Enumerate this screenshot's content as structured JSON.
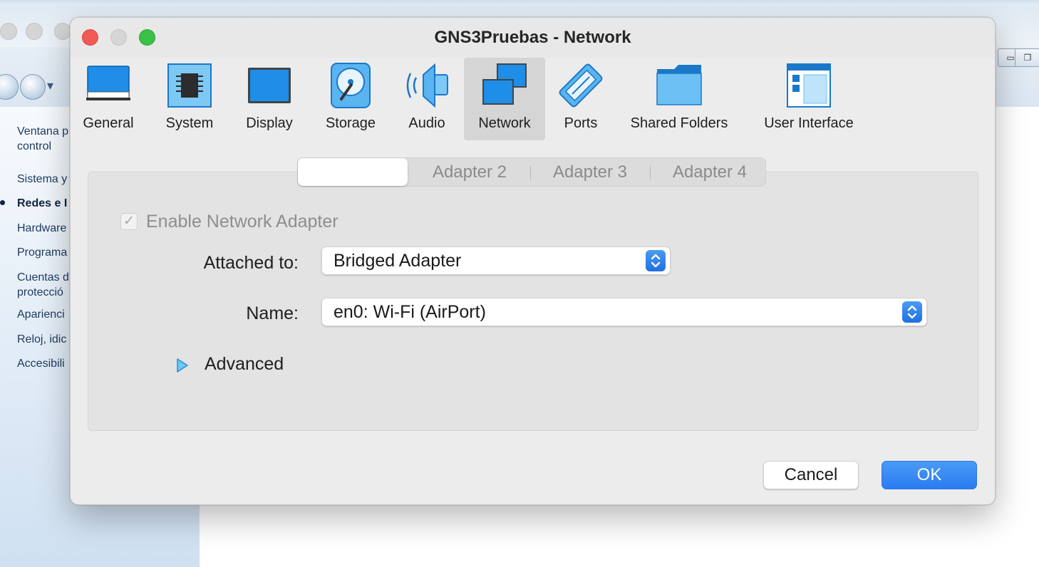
{
  "background_window": {
    "sidebar": [
      {
        "label": "Ventana p",
        "bold": false
      },
      {
        "label": "control",
        "bold": false
      },
      {
        "label": "Sistema y",
        "bold": false
      },
      {
        "label": "Redes e I",
        "bold": true
      },
      {
        "label": "Hardware",
        "bold": false
      },
      {
        "label": "Programa",
        "bold": false
      },
      {
        "label": "Cuentas d",
        "bold": false
      },
      {
        "label": "protecció",
        "bold": false
      },
      {
        "label": "Aparienci",
        "bold": false
      },
      {
        "label": "Reloj, idic",
        "bold": false
      },
      {
        "label": "Accesibili",
        "bold": false
      }
    ]
  },
  "dialog": {
    "title": "GNS3Pruebas - Network",
    "toolbar": [
      {
        "label": "General",
        "icon": "general-icon",
        "selected": false
      },
      {
        "label": "System",
        "icon": "system-icon",
        "selected": false
      },
      {
        "label": "Display",
        "icon": "display-icon",
        "selected": false
      },
      {
        "label": "Storage",
        "icon": "storage-icon",
        "selected": false
      },
      {
        "label": "Audio",
        "icon": "audio-icon",
        "selected": false
      },
      {
        "label": "Network",
        "icon": "network-icon",
        "selected": true
      },
      {
        "label": "Ports",
        "icon": "ports-icon",
        "selected": false
      },
      {
        "label": "Shared Folders",
        "icon": "shared-folders-icon",
        "selected": false
      },
      {
        "label": "User Interface",
        "icon": "user-interface-icon",
        "selected": false
      }
    ],
    "tabs": [
      {
        "label": "",
        "active": true
      },
      {
        "label": "Adapter 2",
        "active": false
      },
      {
        "label": "Adapter 3",
        "active": false
      },
      {
        "label": "Adapter 4",
        "active": false
      }
    ],
    "form": {
      "enable_label": "Enable Network Adapter",
      "enable_checked": true,
      "attached_label": "Attached to:",
      "attached_value": "Bridged Adapter",
      "name_label": "Name:",
      "name_value": "en0: Wi-Fi (AirPort)",
      "advanced_label": "Advanced"
    },
    "buttons": {
      "cancel": "Cancel",
      "ok": "OK"
    }
  },
  "colors": {
    "accent": "#2a7bf0",
    "icon_blue": "#1e8ee8",
    "close": "#f25b55",
    "zoom": "#39c246"
  }
}
